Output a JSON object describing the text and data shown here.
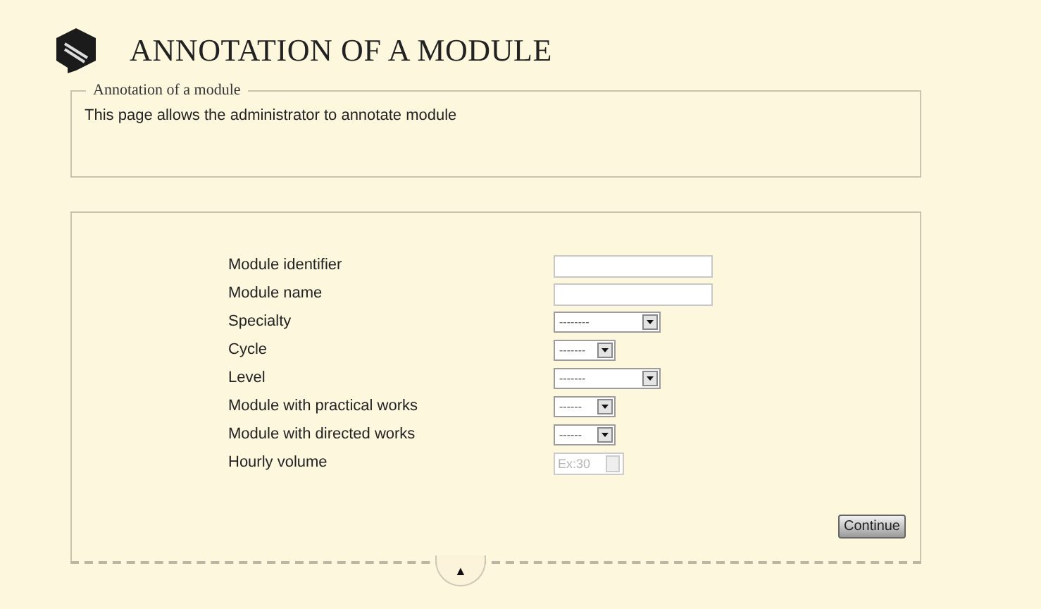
{
  "header": {
    "title": "ANNOTATION OF A MODULE"
  },
  "intro": {
    "legend": "Annotation of a module",
    "text": "This page allows the administrator to annotate module"
  },
  "form": {
    "fields": [
      {
        "label": "Module identifier",
        "kind": "text"
      },
      {
        "label": "Module name",
        "kind": "text"
      },
      {
        "label": "Specialty",
        "kind": "select",
        "value": "--------",
        "wide": true
      },
      {
        "label": "Cycle",
        "kind": "select",
        "value": "-------",
        "wide": false
      },
      {
        "label": "Level",
        "kind": "select",
        "value": "-------",
        "wide": true
      },
      {
        "label": "Module with practical works",
        "kind": "select",
        "value": "------",
        "wide": false
      },
      {
        "label": "Module with directed works",
        "kind": "select",
        "value": "------",
        "wide": false
      },
      {
        "label": "Hourly volume",
        "kind": "number",
        "placeholder": "Ex:30",
        "disabled": true
      }
    ],
    "submit": "Continue"
  },
  "footer": {
    "toggle": "▲"
  }
}
